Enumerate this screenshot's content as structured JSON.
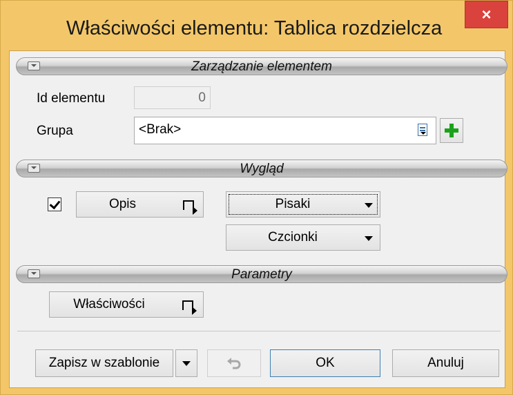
{
  "window": {
    "title": "Właściwości elementu: Tablica rozdzielcza",
    "close_label": "×"
  },
  "sections": {
    "management": "Zarządzanie elementem",
    "appearance": "Wygląd",
    "parameters": "Parametry"
  },
  "management": {
    "id_label": "Id elementu",
    "id_value": "0",
    "group_label": "Grupa",
    "group_value": "<Brak>"
  },
  "appearance": {
    "description_checked": true,
    "description_button": "Opis",
    "pens_button": "Pisaki",
    "fonts_button": "Czcionki"
  },
  "parameters": {
    "properties_button": "Właściwości"
  },
  "footer": {
    "save_template": "Zapisz w szablonie",
    "ok": "OK",
    "cancel": "Anuluj"
  },
  "colors": {
    "frame": "#f3c769",
    "close": "#d9423d",
    "add_icon": "#1aa31a"
  },
  "icons": {
    "group_browse": "document-icon",
    "group_add": "plus-icon",
    "undo": "undo-icon"
  }
}
